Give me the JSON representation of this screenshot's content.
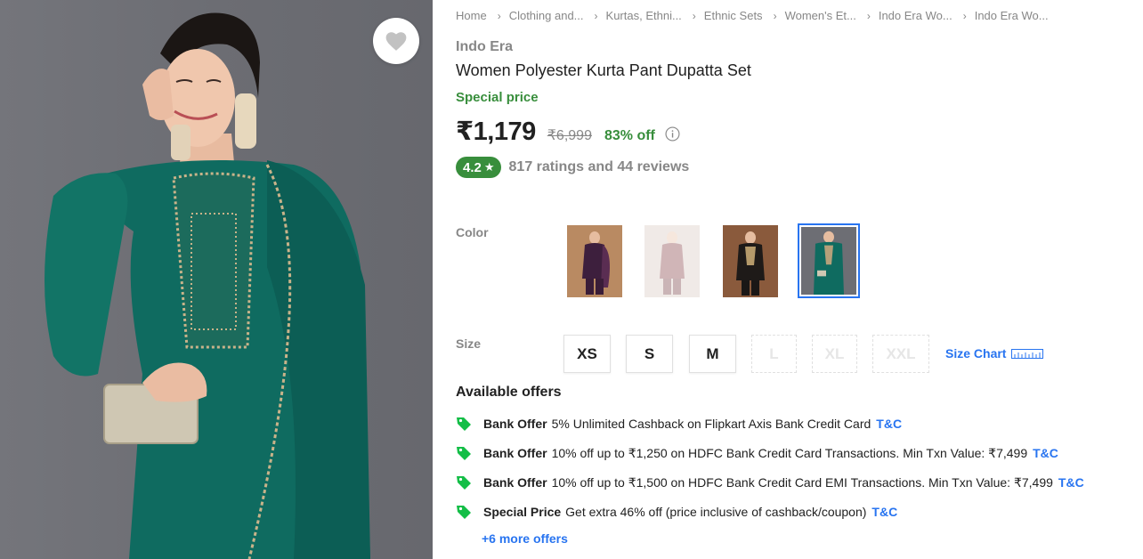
{
  "breadcrumb": [
    {
      "label": "Home"
    },
    {
      "label": "Clothing and..."
    },
    {
      "label": "Kurtas, Ethni..."
    },
    {
      "label": "Ethnic Sets"
    },
    {
      "label": "Women's Et..."
    },
    {
      "label": "Indo Era Wo..."
    },
    {
      "label": "Indo Era Wo..."
    }
  ],
  "product": {
    "brand": "Indo Era",
    "title": "Women Polyester Kurta Pant Dupatta Set",
    "special_label": "Special price",
    "price": "₹1,179",
    "mrp": "₹6,999",
    "discount": "83% off",
    "rating": "4.2",
    "rating_star": "★",
    "reviews_text": "817 ratings and 44 reviews",
    "wishlist_icon": "heart-icon",
    "info_icon": "info-icon"
  },
  "colors": {
    "label": "Color",
    "options": [
      {
        "name": "purple-variant",
        "swatch": "#4a2a4a",
        "selected": false,
        "available": true
      },
      {
        "name": "maroon-variant",
        "swatch": "#d9c5c3",
        "selected": false,
        "available": false
      },
      {
        "name": "black-variant",
        "swatch": "#2b2420",
        "selected": false,
        "available": true
      },
      {
        "name": "green-variant",
        "swatch": "#0f6b5e",
        "selected": true,
        "available": true
      }
    ]
  },
  "sizes": {
    "label": "Size",
    "options": [
      {
        "label": "XS",
        "available": true
      },
      {
        "label": "S",
        "available": true
      },
      {
        "label": "M",
        "available": true
      },
      {
        "label": "L",
        "available": false
      },
      {
        "label": "XL",
        "available": false
      },
      {
        "label": "XXL",
        "available": false
      }
    ],
    "chart_label": "Size Chart",
    "chart_icon": "ruler-icon"
  },
  "offers": {
    "title": "Available offers",
    "items": [
      {
        "type": "Bank Offer",
        "text": "5% Unlimited Cashback on Flipkart Axis Bank Credit Card",
        "tc": "T&C"
      },
      {
        "type": "Bank Offer",
        "text": "10% off up to ₹1,250 on HDFC Bank Credit Card Transactions. Min Txn Value: ₹7,499",
        "tc": "T&C"
      },
      {
        "type": "Bank Offer",
        "text": "10% off up to ₹1,500 on HDFC Bank Credit Card EMI Transactions. Min Txn Value: ₹7,499",
        "tc": "T&C"
      },
      {
        "type": "Special Price",
        "text": "Get extra 46% off (price inclusive of cashback/coupon)",
        "tc": "T&C"
      }
    ],
    "more_label": "+6 more offers",
    "tag_icon": "offer-tag-icon"
  },
  "theme": {
    "accent": "#2874f0",
    "green": "#388e3c",
    "muted": "#878787"
  }
}
